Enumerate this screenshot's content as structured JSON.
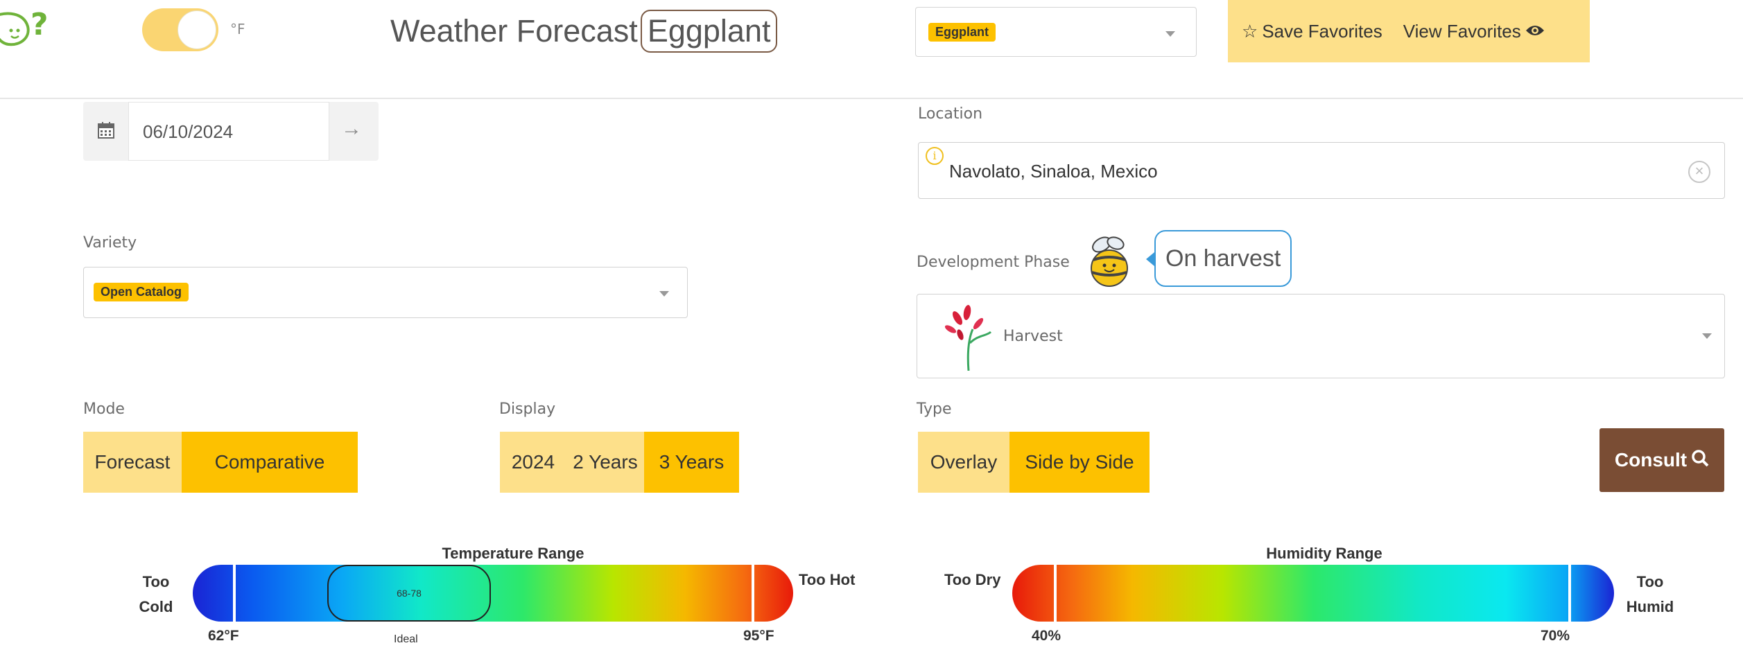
{
  "header": {
    "logo_icon": "eggplant-question-icon",
    "unit_label": "°F",
    "title": "Weather Forecast",
    "title_crop": "Eggplant",
    "crop_select": "Eggplant",
    "save_favorites": "Save Favorites",
    "view_favorites": "View Favorites"
  },
  "date": {
    "value": "06/10/2024"
  },
  "location": {
    "label": "Location",
    "value": "Navolato, Sinaloa, Mexico"
  },
  "variety": {
    "label": "Variety",
    "value": "Open Catalog"
  },
  "development": {
    "label": "Development Phase",
    "status": "On harvest",
    "value": "Harvest"
  },
  "mode": {
    "label": "Mode",
    "options": [
      "Forecast",
      "Comparative"
    ],
    "selected": "Comparative"
  },
  "display": {
    "label": "Display",
    "options": [
      "2024",
      "2 Years",
      "3 Years"
    ],
    "selected": "3 Years"
  },
  "type": {
    "label": "Type",
    "options": [
      "Overlay",
      "Side by Side"
    ],
    "selected": "Side by Side"
  },
  "consult": {
    "label": "Consult"
  },
  "temperature_range": {
    "title": "Temperature Range",
    "too_cold": [
      "Too",
      "Cold"
    ],
    "too_hot": "Too Hot",
    "min": "62°F",
    "max": "95°F",
    "ideal_range": "68-78",
    "ideal_label": "Ideal"
  },
  "humidity_range": {
    "title": "Humidity Range",
    "too_dry": "Too Dry",
    "too_humid": [
      "Too",
      "Humid"
    ],
    "min": "40%",
    "max": "70%"
  },
  "colors": {
    "accent": "#fdc100",
    "accent_light": "#fde08a",
    "consult_bg": "#7a4d34",
    "info": "#3a9ad9"
  }
}
